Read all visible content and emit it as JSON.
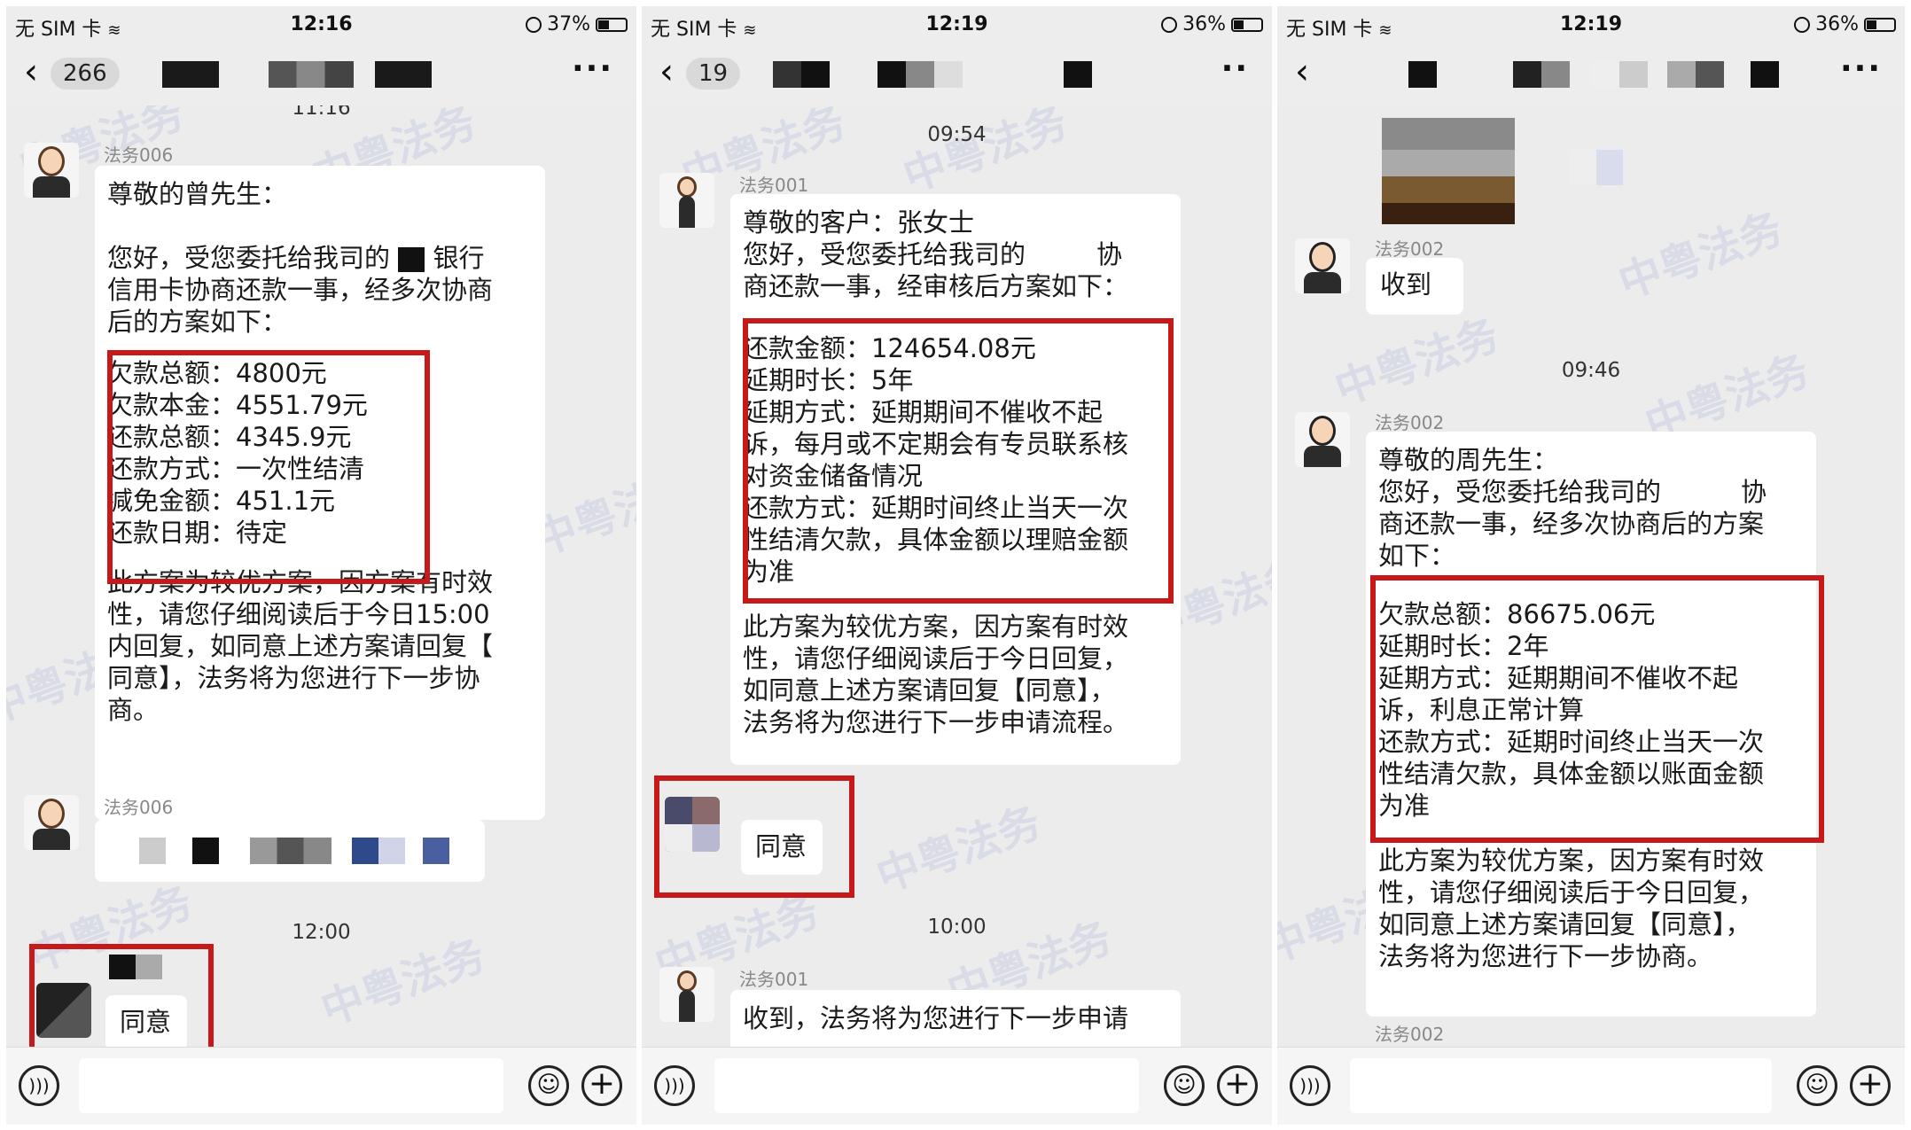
{
  "panels": [
    {
      "status": {
        "carrier": "无 SIM 卡",
        "time": "12:16",
        "battery": "37%"
      },
      "nav": {
        "back_count": "266"
      },
      "messages": {
        "top_time": "11:16",
        "sender_a": "法务006",
        "greeting": "尊敬的曾先生：",
        "intro": [
          "您好，受您委托给我司的",
          "银行",
          "信用卡协商还款一事，经多次协商",
          "后的方案如下："
        ],
        "plan": [
          "欠款总额：4800元",
          "欠款本金：4551.79元",
          "还款总额：4345.9元",
          "还款方式：一次性结清",
          "减免金额：451.1元",
          "还款日期：待定"
        ],
        "closing": [
          "此方案为较优方案，因方案有时效",
          "性，请您仔细阅读后于今日15:00",
          "内回复，如同意上述方案请回复【",
          "同意】，法务将为您进行下一步协",
          "商。"
        ],
        "sender_b": "法务006",
        "time_2": "12:00",
        "reply": "同意"
      }
    },
    {
      "status": {
        "carrier": "无 SIM 卡",
        "time": "12:19",
        "battery": "36%"
      },
      "nav": {
        "back_count": "19"
      },
      "messages": {
        "top_time": "09:54",
        "sender_a": "法务001",
        "greeting": "尊敬的客户：张女士",
        "intro": [
          "您好，受您委托给我司的",
          "协",
          "商还款一事，经审核后方案如下："
        ],
        "plan": [
          "还款金额：124654.08元",
          "延期时长：5年",
          "延期方式：延期期间不催收不起",
          "诉，每月或不定期会有专员联系核",
          "对资金储备情况",
          "还款方式：延期时间终止当天一次",
          "性结清欠款，具体金额以理赔金额",
          "为准"
        ],
        "closing": [
          "此方案为较优方案，因方案有时效",
          "性，请您仔细阅读后于今日回复，",
          "如同意上述方案请回复【同意】，",
          "法务将为您进行下一步申请流程。"
        ],
        "reply": "同意",
        "time_2": "10:00",
        "sender_b": "法务001",
        "followup": "收到，法务将为您进行下一步申请"
      }
    },
    {
      "status": {
        "carrier": "无 SIM 卡",
        "time": "12:19",
        "battery": "36%"
      },
      "messages": {
        "sender_a": "法务002",
        "received": "收到",
        "time_1": "09:46",
        "sender_b": "法务002",
        "greeting": "尊敬的周先生：",
        "intro": [
          "您好，受您委托给我司的",
          "协",
          "商还款一事，经多次协商后的方案",
          "如下："
        ],
        "plan": [
          "欠款总额：86675.06元",
          "延期时长：2年",
          "延期方式：延期期间不催收不起",
          "诉，利息正常计算",
          "还款方式：延期时间终止当天一次",
          "性结清欠款，具体金额以账面金额",
          "为准"
        ],
        "closing": [
          "此方案为较优方案，因方案有时效",
          "性，请您仔细阅读后于今日回复，",
          "如同意上述方案请回复【同意】，",
          "法务将为您进行下一步协商。"
        ],
        "sender_c": "法务002"
      }
    }
  ],
  "watermark": "中粤法务",
  "colors": {
    "highlight_red": "#c61a1a",
    "chat_bg": "#ececec",
    "bubble_bg": "#ffffff"
  },
  "icons": [
    "back-chevron-icon",
    "more-dots-icon",
    "voice-icon",
    "emoji-icon",
    "plus-icon",
    "wifi-icon",
    "battery-icon"
  ]
}
